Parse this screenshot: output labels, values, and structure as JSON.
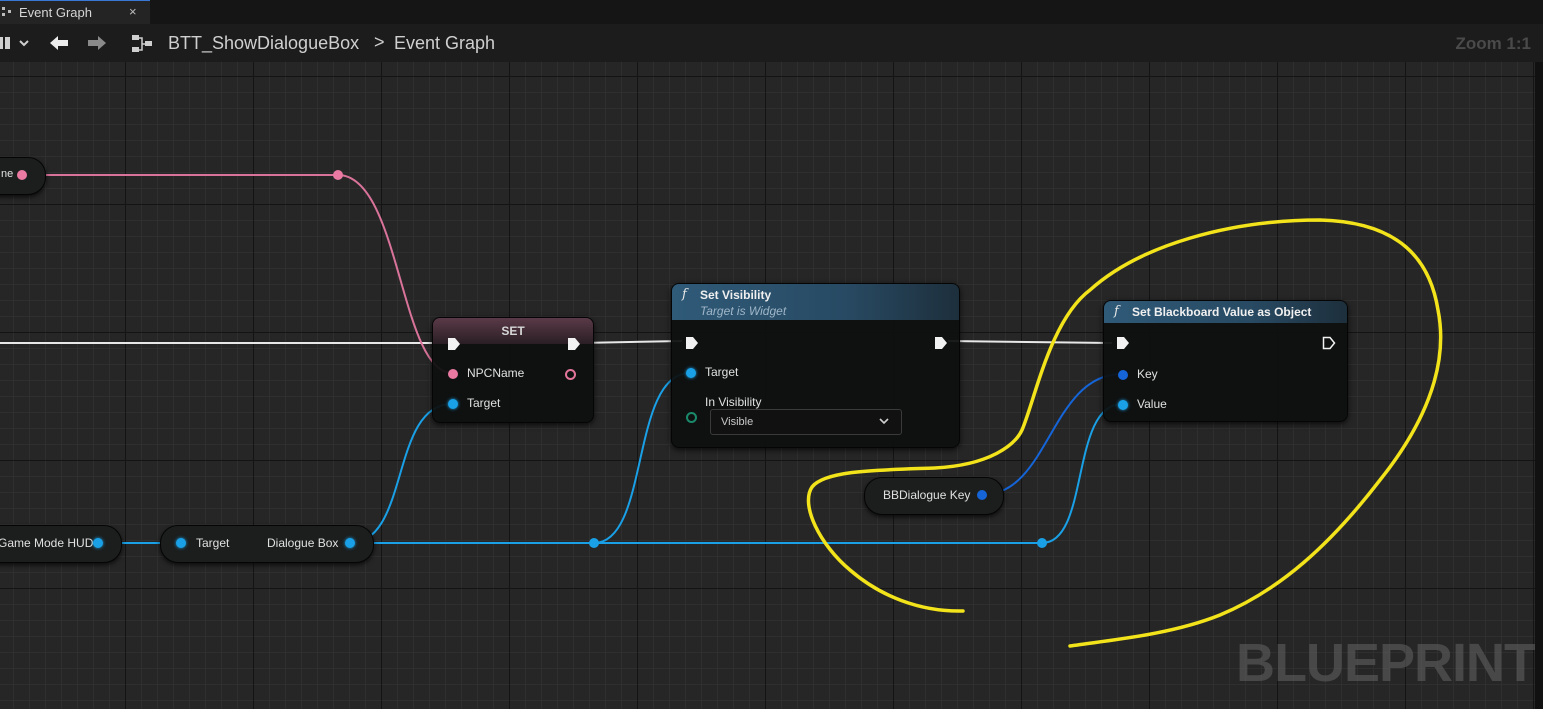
{
  "tab": {
    "title": "Event Graph",
    "close": "×"
  },
  "toolbar": {
    "breadcrumb_asset": "BTT_ShowDialogueBox",
    "breadcrumb_sep": ">",
    "breadcrumb_graph": "Event Graph",
    "zoom": "Zoom 1:1"
  },
  "nodes": {
    "left_var_partial": {
      "label": "ne"
    },
    "hud_var_partial": {
      "label": "Game Mode HUD"
    },
    "get_dialogue_box": {
      "in_label": "Target",
      "out_label": "Dialogue Box"
    },
    "set_node": {
      "title": "SET",
      "pin_npcname": "NPCName",
      "pin_target": "Target"
    },
    "set_visibility": {
      "fn_glyph": "f",
      "title": "Set Visibility",
      "subtitle": "Target is Widget",
      "pin_target": "Target",
      "pin_visibility": "In Visibility",
      "visibility_value": "Visible"
    },
    "set_blackboard": {
      "fn_glyph": "f",
      "title": "Set Blackboard Value as Object",
      "pin_key": "Key",
      "pin_value": "Value"
    },
    "bb_dialogue_key": {
      "label": "BBDialogue Key"
    }
  },
  "watermark": "BLUEPRINT",
  "colors": {
    "exec_wire": "#e8e8e8",
    "string_wire": "#d9739a",
    "object_wire": "#1aa0e6",
    "key_wire": "#1565d8",
    "annotation": "#f2e31b"
  },
  "icons": {
    "tab": "graph-icon",
    "back": "arrow-left-icon",
    "forward": "arrow-right-icon",
    "crumb": "graph-icon",
    "dropdown": "chevron-down-icon"
  }
}
